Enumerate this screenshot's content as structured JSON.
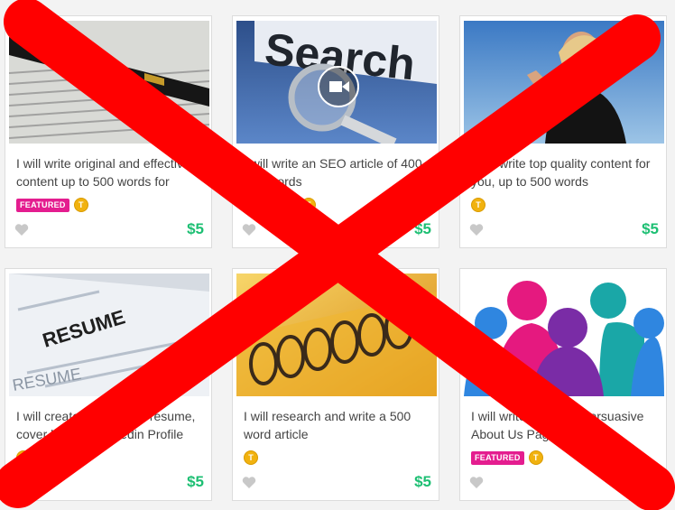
{
  "colors": {
    "cross": "#ff0000",
    "price": "#1dbf73",
    "featured_badge": "#e41d8f",
    "top_rated_badge": "#f1b20f",
    "heart": "#c8c8c8"
  },
  "badges": {
    "featured_label": "FEATURED",
    "top_rated_label": "T"
  },
  "cards": [
    {
      "title": "I will write original and effective content up to 500 words for",
      "price": "$5",
      "featured": true,
      "top_rated": true,
      "image": "pen-document"
    },
    {
      "title": "I will write an SEO article of 400 - 500 words",
      "price": "$5",
      "featured": true,
      "top_rated": true,
      "image": "search-magnifier"
    },
    {
      "title": "I will write top quality content for you, up to 500 words",
      "price": "$5",
      "featured": false,
      "top_rated": true,
      "image": "woman-sky"
    },
    {
      "title": "I will create or edit your resume, cover letter or Linkedin Profile",
      "price": "$5",
      "featured": false,
      "top_rated": true,
      "image": "resume-paper"
    },
    {
      "title": "I will research and write a 500 word article",
      "price": "$5",
      "featured": false,
      "top_rated": true,
      "image": "spiral-notebook"
    },
    {
      "title": "I will write the Most Persuasive About Us Page",
      "price": "$5",
      "featured": true,
      "top_rated": true,
      "image": "people-silhouettes"
    }
  ]
}
